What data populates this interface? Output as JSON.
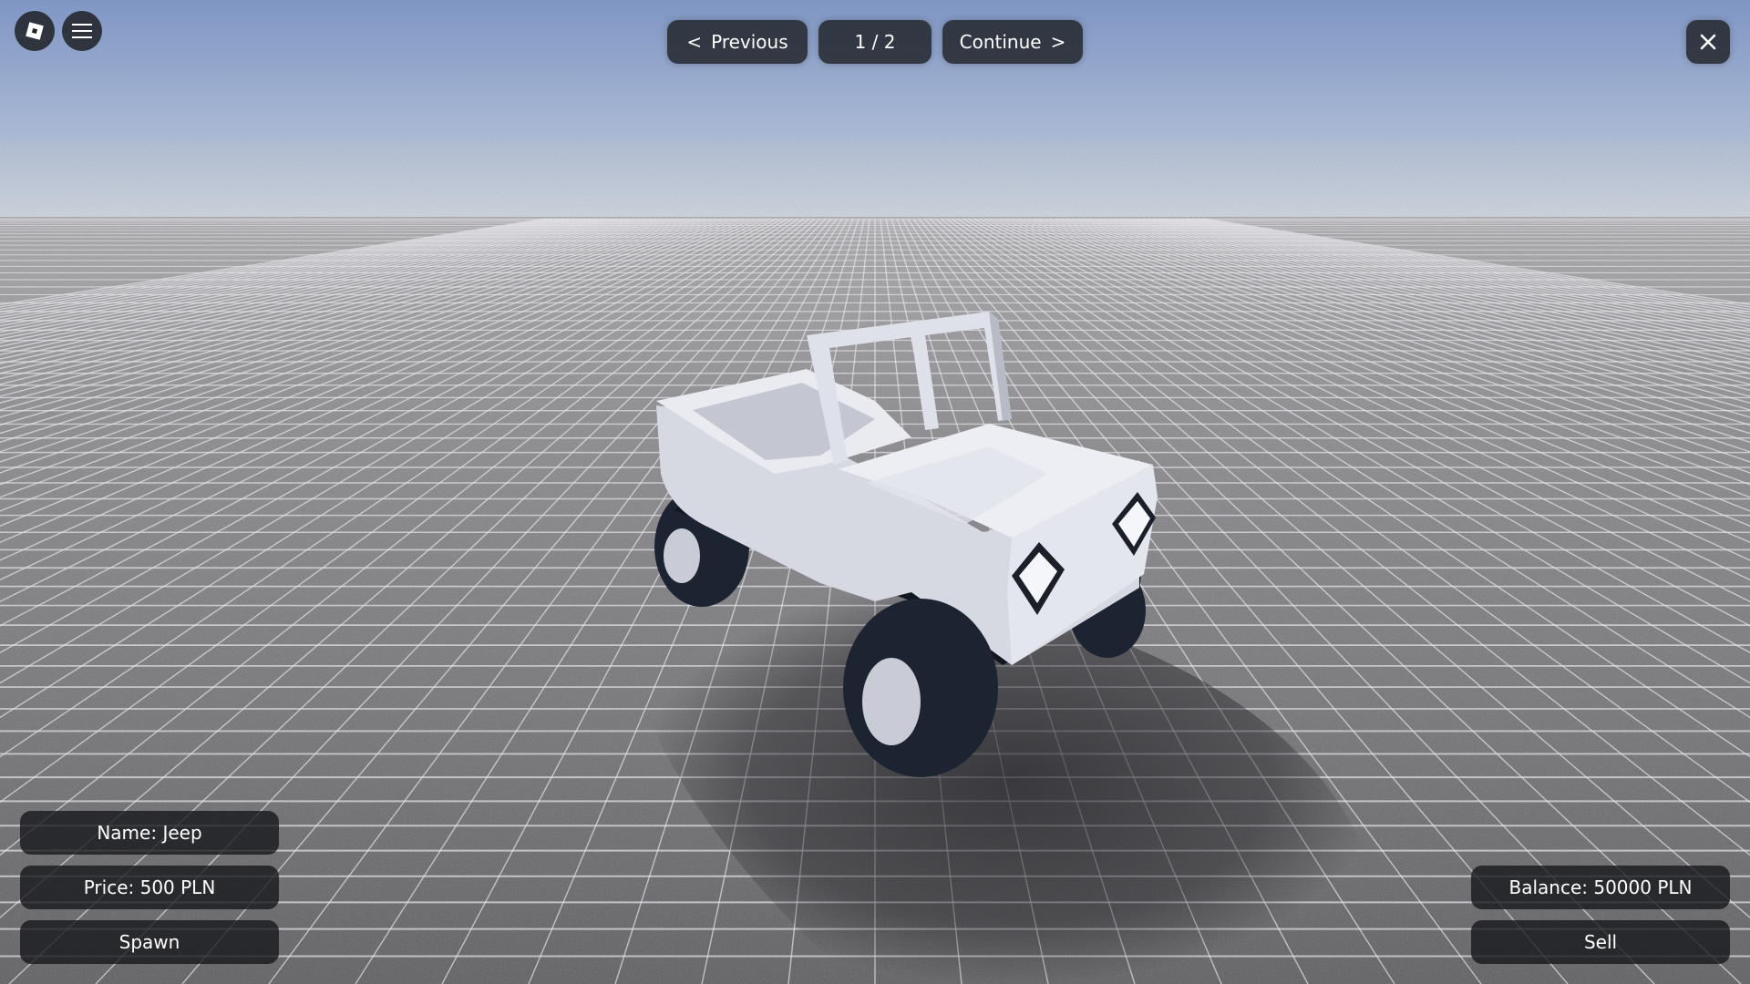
{
  "topbar": {
    "previous_arrow": "<",
    "previous_label": "Previous",
    "page_indicator": "1 / 2",
    "continue_label": "Continue",
    "continue_arrow": ">"
  },
  "vehicle": {
    "name": "Name: Jeep",
    "price": "Price: 500 PLN",
    "spawn_label": "Spawn"
  },
  "player": {
    "balance": "Balance: 50000 PLN",
    "sell_label": "Sell"
  },
  "icons": {
    "roblox": "roblox-logo-icon",
    "menu": "hamburger-menu-icon",
    "close": "close-icon"
  },
  "colors": {
    "panel": "#1e2126",
    "text": "#ffffff",
    "sky_top": "#7d93c2",
    "sky_horizon": "#c9d2de",
    "ground": "#6d6d70",
    "jeep_body": "#dfe1ea",
    "tire": "#1c2431"
  }
}
